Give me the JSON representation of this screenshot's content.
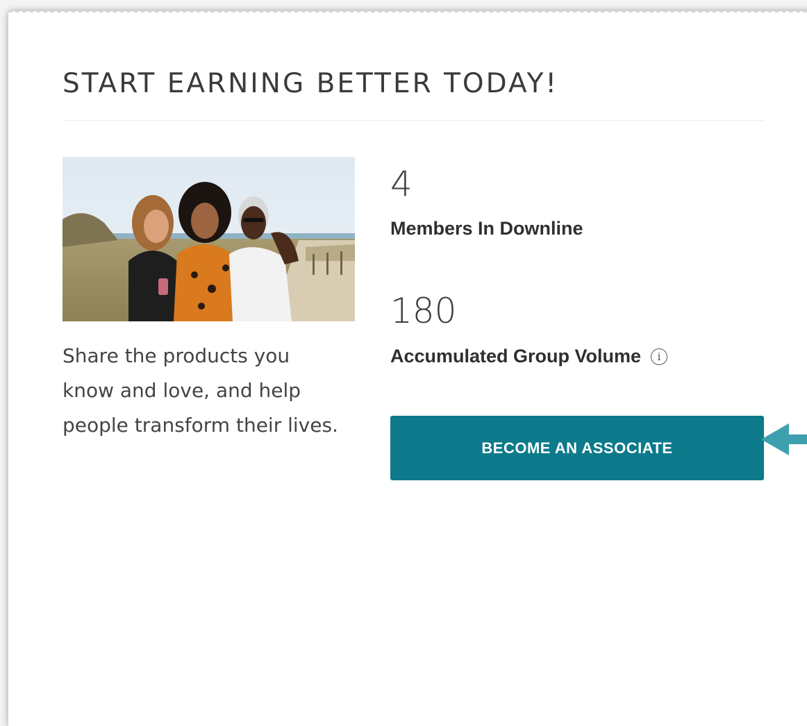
{
  "card": {
    "title": "START EARNING BETTER TODAY!",
    "blurb": "Share the products you know and love, and help people transform their lives."
  },
  "stats": {
    "members": {
      "value": "4",
      "label": "Members In Downline"
    },
    "volume": {
      "value": "180",
      "label": "Accumulated Group Volume"
    }
  },
  "cta": {
    "label": "BECOME AN ASSOCIATE"
  },
  "icons": {
    "info": "info-icon",
    "pointer": "arrow-left-icon"
  },
  "colors": {
    "brand": "#0c7a8a",
    "pointer": "#3e9fae"
  }
}
